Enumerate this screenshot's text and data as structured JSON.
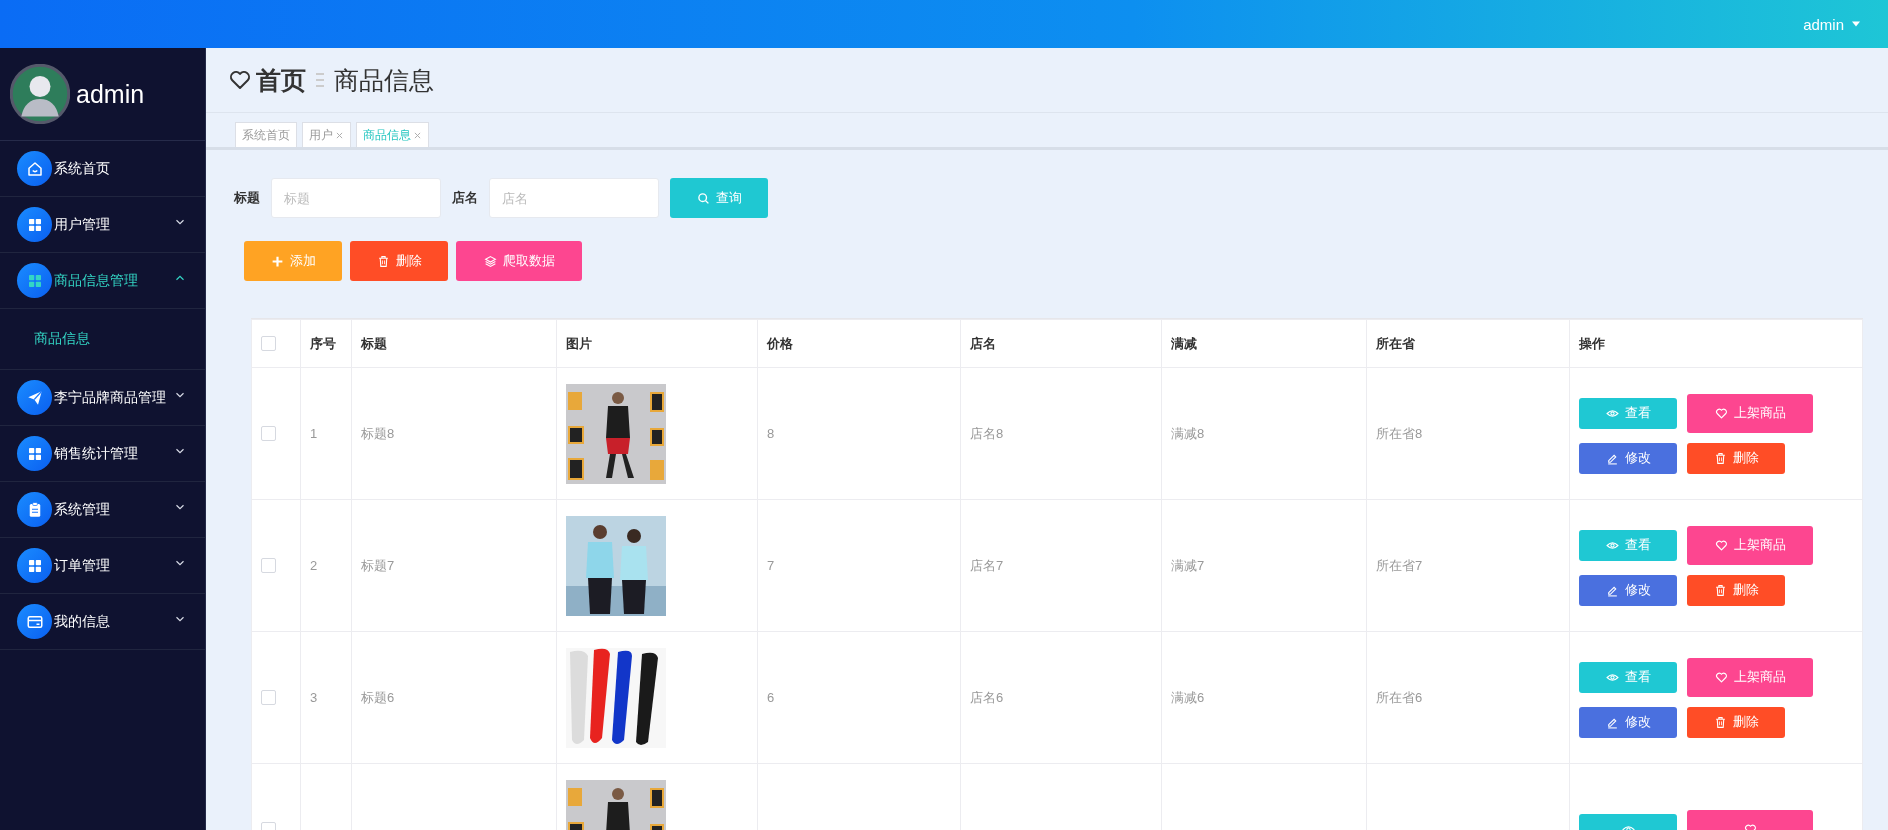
{
  "top_bar": {
    "user": "admin"
  },
  "sidebar": {
    "user": "admin",
    "items": [
      {
        "label": "系统首页",
        "kind": "link",
        "expanded": false
      },
      {
        "label": "用户管理",
        "kind": "group",
        "expanded": false
      },
      {
        "label": "商品信息管理",
        "kind": "group",
        "expanded": true,
        "children": [
          {
            "label": "商品信息",
            "selected": true
          }
        ]
      },
      {
        "label": "李宁品牌商品管理",
        "kind": "group",
        "expanded": false
      },
      {
        "label": "销售统计管理",
        "kind": "group",
        "expanded": false
      },
      {
        "label": "系统管理",
        "kind": "group",
        "expanded": false
      },
      {
        "label": "订单管理",
        "kind": "group",
        "expanded": false
      },
      {
        "label": "我的信息",
        "kind": "group",
        "expanded": false
      }
    ]
  },
  "breadcrumb": {
    "home": "首页",
    "current": "商品信息"
  },
  "tabs": [
    {
      "label": "系统首页",
      "closable": false,
      "selected": false
    },
    {
      "label": "用户",
      "closable": true,
      "selected": false
    },
    {
      "label": "商品信息",
      "closable": true,
      "selected": true
    }
  ],
  "search": {
    "fields": [
      {
        "label": "标题",
        "placeholder": "标题"
      },
      {
        "label": "店名",
        "placeholder": "店名"
      }
    ],
    "button": "查询"
  },
  "toolbar": [
    {
      "label": "添加",
      "kind": "add"
    },
    {
      "label": "删除",
      "kind": "delete"
    },
    {
      "label": "爬取数据",
      "kind": "crawl"
    }
  ],
  "table": {
    "all_checked": false,
    "columns": [
      "序号",
      "标题",
      "图片",
      "价格",
      "店名",
      "满减",
      "所在省",
      "操作"
    ],
    "rows": [
      {
        "checked": false,
        "index": "1",
        "title": "标题8",
        "price": "8",
        "shop": "店名8",
        "discount": "满减8",
        "province": "所在省8",
        "actions": [
          {
            "label": "查看",
            "kind": "view"
          },
          {
            "label": "上架商品",
            "kind": "list"
          },
          {
            "label": "修改",
            "kind": "edit"
          },
          {
            "label": "删除",
            "kind": "delete"
          }
        ]
      },
      {
        "checked": false,
        "index": "2",
        "title": "标题7",
        "price": "7",
        "shop": "店名7",
        "discount": "满减7",
        "province": "所在省7",
        "actions": [
          {
            "label": "查看",
            "kind": "view"
          },
          {
            "label": "上架商品",
            "kind": "list"
          },
          {
            "label": "修改",
            "kind": "edit"
          },
          {
            "label": "删除",
            "kind": "delete"
          }
        ]
      },
      {
        "checked": false,
        "index": "3",
        "title": "标题6",
        "price": "6",
        "shop": "店名6",
        "discount": "满减6",
        "province": "所在省6",
        "actions": [
          {
            "label": "查看",
            "kind": "view"
          },
          {
            "label": "上架商品",
            "kind": "list"
          },
          {
            "label": "修改",
            "kind": "edit"
          },
          {
            "label": "删除",
            "kind": "delete"
          }
        ]
      },
      {
        "checked": false,
        "actions": [
          {
            "kind": "view"
          },
          {
            "kind": "list"
          }
        ]
      }
    ]
  }
}
